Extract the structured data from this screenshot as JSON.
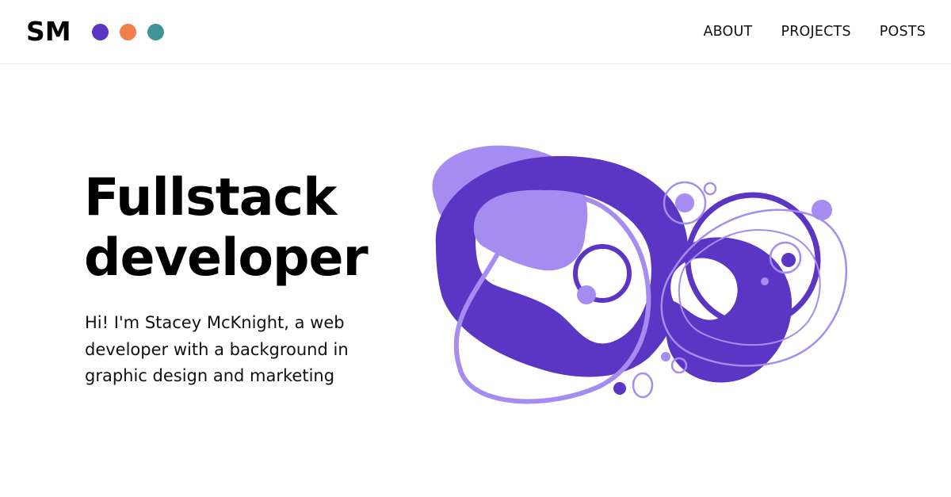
{
  "header": {
    "logo_text": "SM",
    "dots": [
      "#5b35c4",
      "#f07f4a",
      "#3e9496"
    ],
    "nav": [
      {
        "label": "ABOUT"
      },
      {
        "label": "PROJECTS"
      },
      {
        "label": "POSTS"
      }
    ]
  },
  "hero": {
    "title_line1": "Fullstack",
    "title_line2": "developer",
    "subtitle": "Hi! I'm Stacey McKnight, a web developer with a background in graphic design and marketing"
  },
  "colors": {
    "accent_dark": "#5b35c4",
    "accent_light": "#a68cf0"
  }
}
